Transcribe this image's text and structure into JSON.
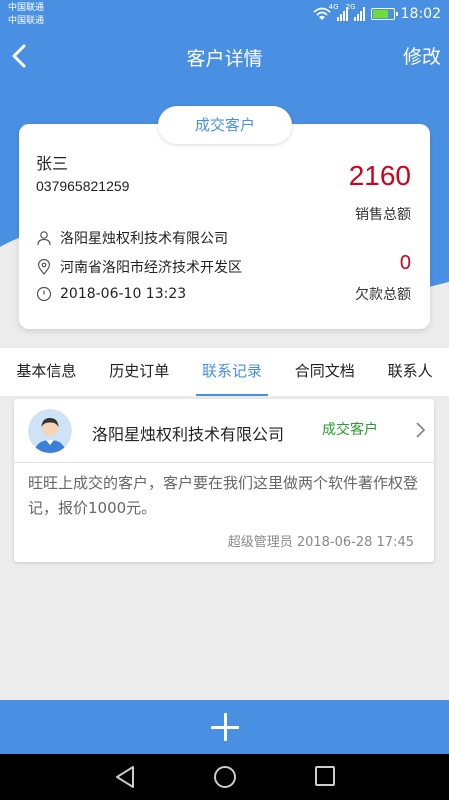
{
  "status_bar": {
    "carrier1": "中国联通",
    "carrier2": "中国联通",
    "net1": "4G",
    "net2": "2G",
    "time": "18:02",
    "battery_level": 0.8
  },
  "header": {
    "title": "客户详情",
    "edit_label": "修改",
    "back_icon": "chevron-left-icon"
  },
  "customer": {
    "status": "成交客户",
    "name": "张三",
    "phone": "037965821259",
    "sales_total": "2160",
    "sales_label": "销售总额",
    "company": "洛阳星烛权利技术有限公司",
    "address": "河南省洛阳市经济技术开发区",
    "created": "2018-06-10 13:23",
    "debt_total": "0",
    "debt_label": "欠款总额"
  },
  "tabs": [
    {
      "label": "基本信息",
      "active": false
    },
    {
      "label": "历史订单",
      "active": false
    },
    {
      "label": "联系记录",
      "active": true
    },
    {
      "label": "合同文档",
      "active": false
    },
    {
      "label": "联系人",
      "active": false
    }
  ],
  "record": {
    "company": "洛阳星烛权利技术有限公司",
    "status": "成交客户",
    "content": "旺旺上成交的客户，客户要在我们这里做两个软件著作权登记，报价1000元。",
    "author_time": "超级管理员 2018-06-28 17:45"
  },
  "colors": {
    "primary": "#4a90e2",
    "accent_red": "#d0021b",
    "status_green": "#27a02b"
  }
}
